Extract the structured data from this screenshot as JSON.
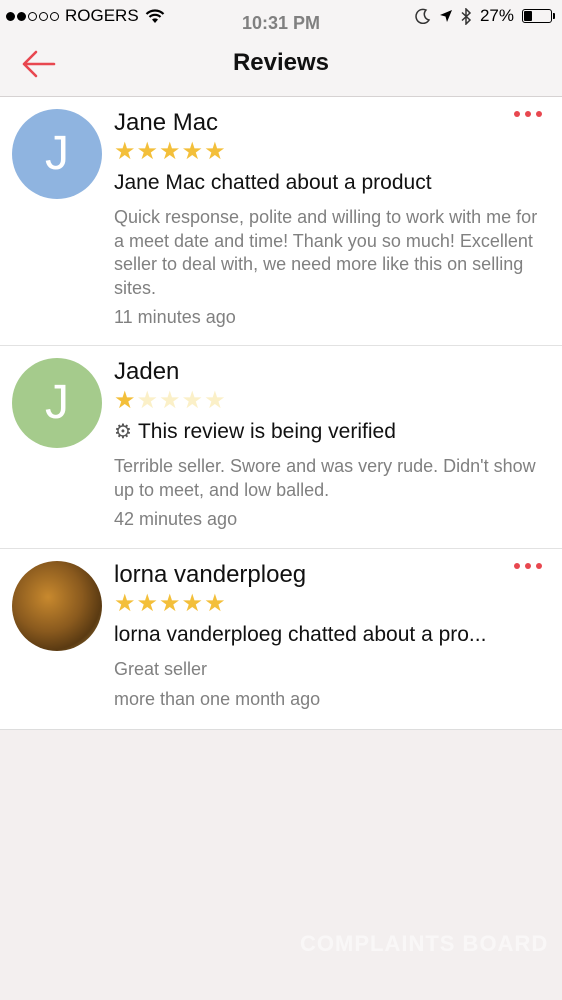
{
  "status_bar": {
    "carrier": "ROGERS",
    "time": "10:31 PM",
    "battery": "27%",
    "battery_level": 0.27
  },
  "nav": {
    "title": "Reviews",
    "back_icon": "arrow-left-icon",
    "accent_color": "#e8474f"
  },
  "reviews": [
    {
      "name": "Jane Mac",
      "avatar_letter": "J",
      "avatar_color": "#8fb4e0",
      "rating": 5,
      "headline": "Jane Mac chatted about a product",
      "text": "Quick response, polite and willing to work with me for a meet date and time!  Thank you so much!  Excellent seller to deal with, we need more like this on selling sites.",
      "time": "11 minutes ago"
    },
    {
      "name": "Jaden",
      "avatar_letter": "J",
      "avatar_color": "#a5cb8c",
      "rating": 1,
      "headline": "This review is being verified",
      "text": "Terrible seller. Swore and was very rude. Didn't show up to meet, and low balled.",
      "time": "42 minutes ago"
    },
    {
      "name": "lorna vanderploeg",
      "avatar_letter": "",
      "avatar_color": "#8a5a1e",
      "rating": 5,
      "headline": "lorna vanderploeg chatted about a pro...",
      "text": "Great seller",
      "time": "more than one month ago"
    }
  ],
  "star_color": "#f3bf3a",
  "watermark": "COMPLAINTS BOARD"
}
